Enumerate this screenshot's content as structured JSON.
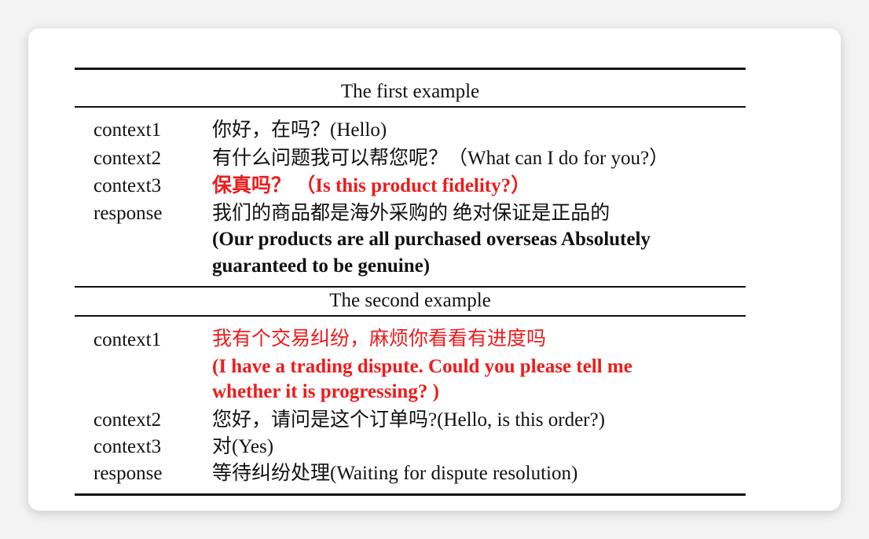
{
  "table": {
    "example1": {
      "title": "The first example",
      "context1_label": "context1",
      "context1_text": "你好，在吗？(Hello)",
      "context2_label": "context2",
      "context2_text": "有什么问题我可以帮您呢？（What can I do for you?）",
      "context3_label": "context3",
      "context3_text": "保真吗？ （Is this product fidelity?）",
      "response_label": "response",
      "response_line1": "我们的商品都是海外采购的  绝对保证是正品的",
      "response_line2": "(Our products are all purchased overseas  Absolutely",
      "response_line3": "guaranteed to be genuine)"
    },
    "example2": {
      "title": "The second example",
      "context1_label": "context1",
      "context1_line1": "我有个交易纠纷，麻烦你看看有进度吗",
      "context1_line2": "(I have a trading dispute. Could you please tell me",
      "context1_line3": "whether it is progressing? )",
      "context2_label": "context2",
      "context2_text": "您好，请问是这个订单吗?(Hello, is this order?)",
      "context3_label": "context3",
      "context3_text": "对(Yes)",
      "response_label": "response",
      "response_text": "等待纠纷处理(Waiting for dispute resolution)"
    }
  },
  "colors": {
    "highlight": "#ee1b1b",
    "text": "#111111"
  }
}
